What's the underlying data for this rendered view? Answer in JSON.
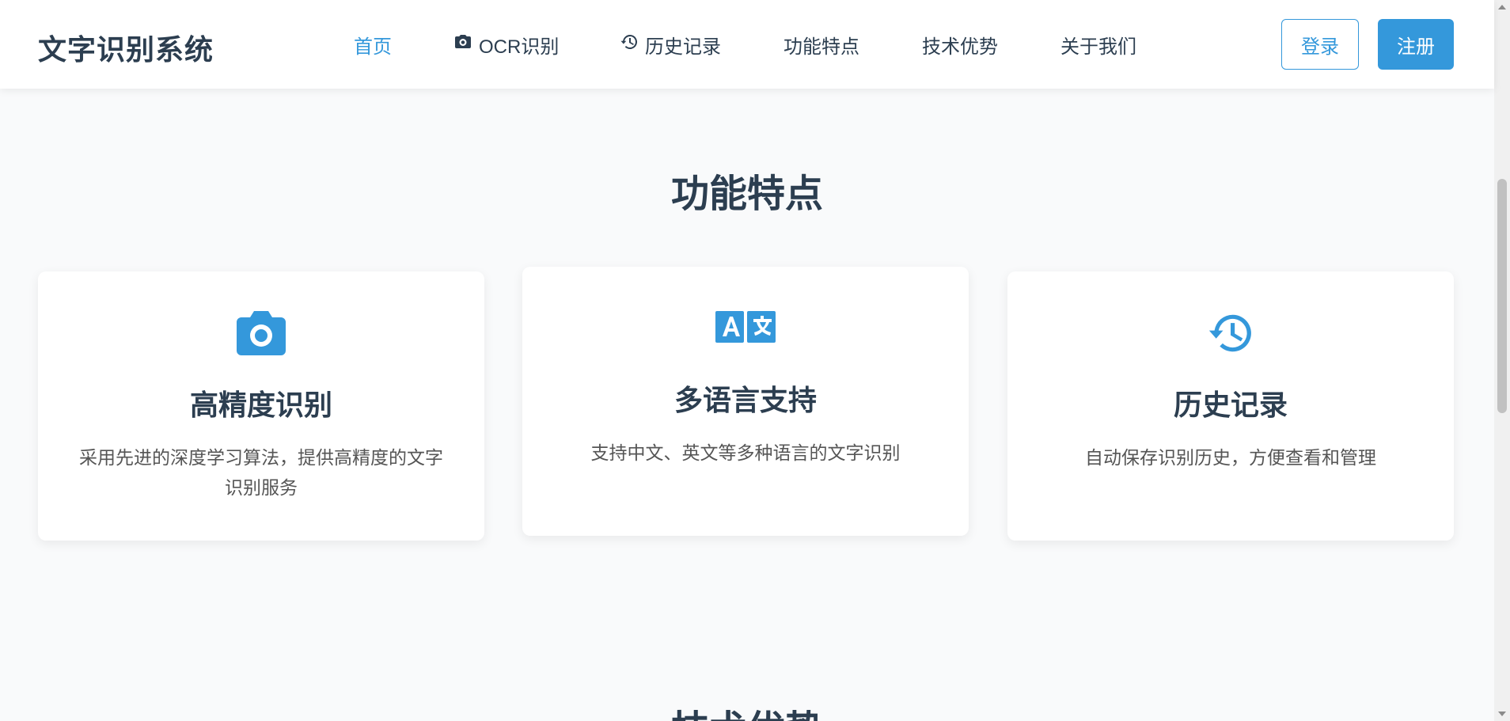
{
  "header": {
    "brand": "文字识别系统",
    "nav": [
      {
        "label": "首页",
        "active": true
      },
      {
        "label": "OCR识别",
        "icon": "camera-icon"
      },
      {
        "label": "历史记录",
        "icon": "history-icon"
      },
      {
        "label": "功能特点"
      },
      {
        "label": "技术优势"
      },
      {
        "label": "关于我们"
      }
    ],
    "login_label": "登录",
    "register_label": "注册"
  },
  "features": {
    "title": "功能特点",
    "cards": [
      {
        "icon": "camera-icon",
        "title": "高精度识别",
        "desc": "采用先进的深度学习算法，提供高精度的文字识别服务"
      },
      {
        "icon": "language-icon",
        "title": "多语言支持",
        "desc": "支持中文、英文等多种语言的文字识别"
      },
      {
        "icon": "history-icon",
        "title": "历史记录",
        "desc": "自动保存识别历史，方便查看和管理"
      }
    ]
  },
  "tech": {
    "title": "技术优势"
  },
  "colors": {
    "accent": "#3498db",
    "text": "#2c3e50",
    "muted": "#555555"
  }
}
